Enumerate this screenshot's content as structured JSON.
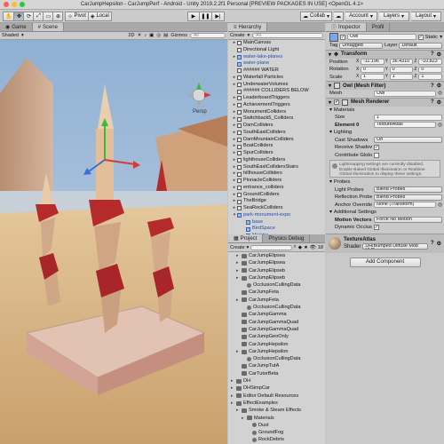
{
  "window": {
    "title": "CarJumpHepsilon - CarJumpPerf - Android - Unity 2019.2.2f1 Personal [PREVIEW PACKAGES IN USE] <OpenGL 4.1>"
  },
  "toolbar": {
    "pivot": "Pivot",
    "local": "Local",
    "collab": "Collab",
    "account": "Account",
    "layers": "Layers",
    "layout": "Layout"
  },
  "scene": {
    "tabs": [
      "Game",
      "Scene"
    ],
    "shading": "Shaded",
    "mode_2d": "2D",
    "gizmos": "Gizmos",
    "search_placeholder": "All",
    "persp": "Persp"
  },
  "hierarchy": {
    "tab": "Hierarchy",
    "create": "Create",
    "search_placeholder": "All",
    "rows": [
      {
        "label": "MainCanvas",
        "color": "black",
        "arrow": "▸"
      },
      {
        "label": "Directional Light",
        "color": "black",
        "arrow": ""
      },
      {
        "label": "water-lake-planes",
        "color": "blue",
        "arrow": "▸"
      },
      {
        "label": "water-plane",
        "color": "blue",
        "arrow": ""
      },
      {
        "label": "###### WATER",
        "color": "black",
        "arrow": ""
      },
      {
        "label": "Waterfall Particles",
        "color": "black",
        "arrow": "▸"
      },
      {
        "label": "UnderwaterVolumes",
        "color": "black",
        "arrow": "▸"
      },
      {
        "label": "###### COLLIDERS BELOW",
        "color": "black",
        "arrow": ""
      },
      {
        "label": "LeaderboardTriggers",
        "color": "black",
        "arrow": "▸"
      },
      {
        "label": "AchievementTriggers",
        "color": "black",
        "arrow": "▸"
      },
      {
        "label": "MonumentColliders",
        "color": "black",
        "arrow": "▸"
      },
      {
        "label": "Switchback5_Colliders",
        "color": "black",
        "arrow": "▸"
      },
      {
        "label": "DamColliders",
        "color": "black",
        "arrow": "▸"
      },
      {
        "label": "SouthEastColliders",
        "color": "black",
        "arrow": "▸"
      },
      {
        "label": "DamMountainColliders",
        "color": "black",
        "arrow": "▸"
      },
      {
        "label": "BoatColliders",
        "color": "black",
        "arrow": "▸"
      },
      {
        "label": "SpurColliders",
        "color": "black",
        "arrow": "▸"
      },
      {
        "label": "lighthouseColliders",
        "color": "black",
        "arrow": "▸"
      },
      {
        "label": "SouthEastCollidersStairs",
        "color": "black",
        "arrow": "▸"
      },
      {
        "label": "hillhouseColliders",
        "color": "black",
        "arrow": "▸"
      },
      {
        "label": "PinnacleColliders",
        "color": "black",
        "arrow": "▸"
      },
      {
        "label": "entrance_colliders",
        "color": "black",
        "arrow": "▸"
      },
      {
        "label": "GroundColliders",
        "color": "black",
        "arrow": "▸"
      },
      {
        "label": "TheBridge",
        "color": "black",
        "arrow": "▸"
      },
      {
        "label": "SeaRockColliders",
        "color": "black",
        "arrow": "▸"
      },
      {
        "label": "park-monument-expo",
        "color": "blue",
        "arrow": "▾"
      },
      {
        "label": "base",
        "color": "blue",
        "arrow": ""
      },
      {
        "label": "BirdSpace",
        "color": "blue",
        "arrow": ""
      },
      {
        "label": "Maistra",
        "color": "blue",
        "arrow": ""
      }
    ]
  },
  "project": {
    "tabs": [
      "Project",
      "Physics Debug"
    ],
    "create": "Create",
    "count": "18",
    "rows": [
      {
        "label": "CarJumpElipsea",
        "indent": 1,
        "kind": "folder-arrow"
      },
      {
        "label": "CarJumpElipsea",
        "indent": 1,
        "kind": "folder-arrow"
      },
      {
        "label": "CarJumpElipseb",
        "indent": 1,
        "kind": "folder-arrow"
      },
      {
        "label": "CarJumpElipseb",
        "indent": 1,
        "kind": "folder-arrow"
      },
      {
        "label": "OcclusionCullingData",
        "indent": 2,
        "kind": "asset"
      },
      {
        "label": "CarJumpFeta",
        "indent": 1,
        "kind": "folder"
      },
      {
        "label": "CarJumpFeta",
        "indent": 1,
        "kind": "folder-arrow"
      },
      {
        "label": "OcclusionCullingData",
        "indent": 2,
        "kind": "asset"
      },
      {
        "label": "CarJumpGamma",
        "indent": 1,
        "kind": "folder"
      },
      {
        "label": "CarJumpGammaQuad",
        "indent": 1,
        "kind": "folder"
      },
      {
        "label": "CarJumpGammaQuad",
        "indent": 1,
        "kind": "folder"
      },
      {
        "label": "CarJumpGeoOnly",
        "indent": 1,
        "kind": "folder"
      },
      {
        "label": "CarJumpHepsilon",
        "indent": 1,
        "kind": "folder"
      },
      {
        "label": "CarJumpHepsilon",
        "indent": 1,
        "kind": "folder-arrow"
      },
      {
        "label": "OcclusionCullingData",
        "indent": 2,
        "kind": "asset"
      },
      {
        "label": "CarJumpTutA",
        "indent": 1,
        "kind": "folder"
      },
      {
        "label": "CarTutorBeta",
        "indent": 1,
        "kind": "folder"
      },
      {
        "label": "DH",
        "indent": 0,
        "kind": "folder-arrow"
      },
      {
        "label": "DHSimpCar",
        "indent": 0,
        "kind": "folder-arrow"
      },
      {
        "label": "Editor Default Resources",
        "indent": 0,
        "kind": "folder-arrow"
      },
      {
        "label": "EffectExamples",
        "indent": 0,
        "kind": "folder-arrow"
      },
      {
        "label": "Smoke & Steam Effects",
        "indent": 1,
        "kind": "folder-arrow"
      },
      {
        "label": "Materials",
        "indent": 2,
        "kind": "folder-arrow"
      },
      {
        "label": "Dust",
        "indent": 3,
        "kind": "asset"
      },
      {
        "label": "GroundFog",
        "indent": 3,
        "kind": "asset"
      },
      {
        "label": "RockDebris",
        "indent": 3,
        "kind": "asset"
      }
    ]
  },
  "inspector": {
    "tabs": [
      "Inspector",
      "Profil"
    ],
    "object_name": "Owl",
    "static_label": "Static",
    "tag_label": "Tag",
    "tag_value": "Untagged",
    "layer_label": "Layer",
    "layer_value": "Default",
    "transform": {
      "title": "Transform",
      "position_label": "Position",
      "position": {
        "x": "-11.196",
        "y": "36.4310",
        "z": "-10.823"
      },
      "rotation_label": "Rotation",
      "rotation": {
        "x": "0",
        "y": "0",
        "z": "0"
      },
      "scale_label": "Scale",
      "scale": {
        "x": "1",
        "y": "1",
        "z": "1"
      }
    },
    "mesh_filter": {
      "title": "Owl (Mesh Filter)",
      "mesh_label": "Mesh",
      "mesh_value": "Owl"
    },
    "mesh_renderer": {
      "title": "Mesh Renderer",
      "materials_label": "Materials",
      "size_label": "Size",
      "size_value": "1",
      "element_label": "Element 0",
      "element_value": "TextureAtlas",
      "lighting_label": "Lighting",
      "cast_shadows_label": "Cast Shadows",
      "cast_shadows_value": "On",
      "receive_shadows_label": "Receive Shadows",
      "contribute_gi_label": "Contribute Global Il",
      "help_text": "Lightmapping settings are currently disabled. Enable Baked Global Illumination or Realtime Global Illumination to display these settings.",
      "probes_label": "Probes",
      "light_probes_label": "Light Probes",
      "light_probes_value": "Blend Probes",
      "reflection_probes_label": "Reflection Probes",
      "reflection_probes_value": "Blend Probes",
      "anchor_override_label": "Anchor Override",
      "anchor_override_value": "None (Transform)",
      "additional_label": "Additional Settings",
      "motion_vectors_label": "Motion Vectors",
      "motion_vectors_value": "Force No Motion",
      "dynamic_occlusion_label": "Dynamic Occlusion"
    },
    "material": {
      "name": "TextureAtlas",
      "shader_label": "Shader",
      "shader_value": "DH/Bumped Diffuse Mob UV2"
    },
    "add_component": "Add Component"
  },
  "colors": {
    "selection": "#3a72d8",
    "sky": "#a9c0d8",
    "sand": "#d9b98a",
    "pillar_red": "#b52a2a",
    "pillar_cream": "#e6c7a4"
  }
}
